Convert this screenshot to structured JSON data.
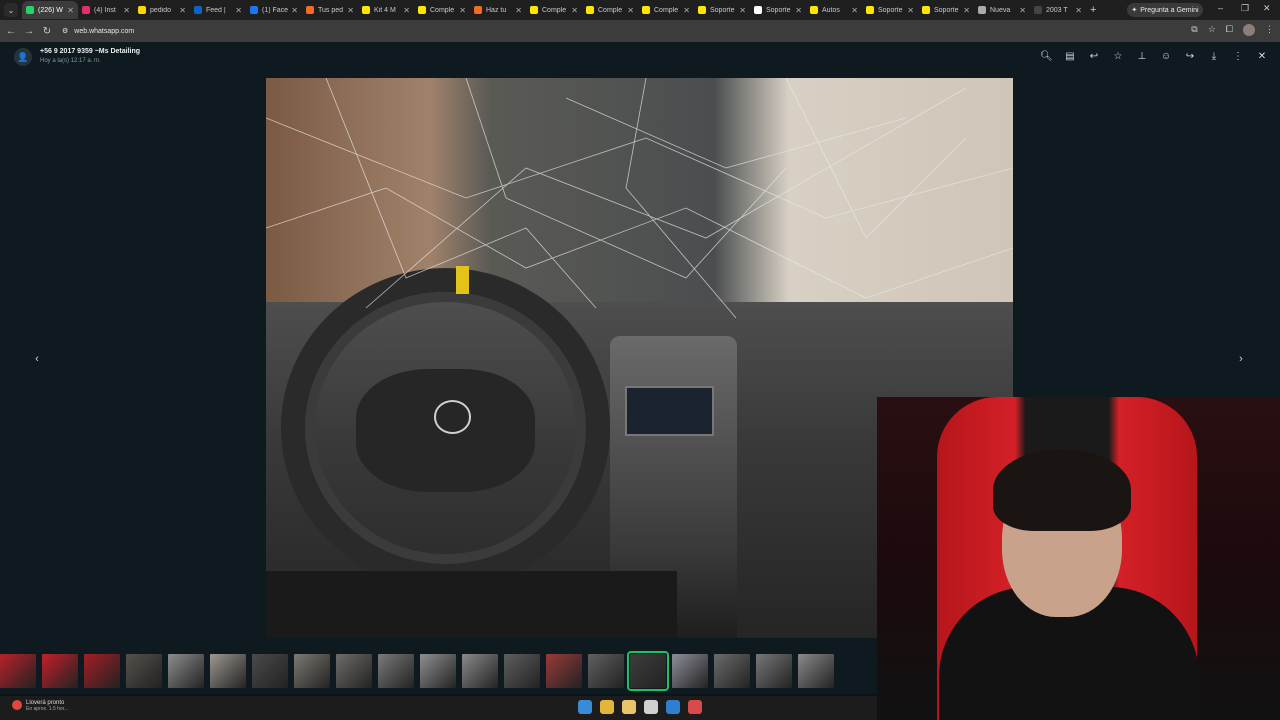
{
  "browser": {
    "tabs": [
      {
        "label": "(226) W",
        "color": "#25d366",
        "active": true
      },
      {
        "label": "(4) Inst",
        "color": "#e1306c"
      },
      {
        "label": "pedido",
        "color": "#ffd700"
      },
      {
        "label": "Feed |",
        "color": "#0a66c2"
      },
      {
        "label": "(1) Face",
        "color": "#1877f2"
      },
      {
        "label": "Tus ped",
        "color": "#f36c21"
      },
      {
        "label": "Kit 4 M",
        "color": "#ffe600"
      },
      {
        "label": "Comple",
        "color": "#ffe600"
      },
      {
        "label": "Haz tu",
        "color": "#f36c21"
      },
      {
        "label": "Comple",
        "color": "#ffe600"
      },
      {
        "label": "Comple",
        "color": "#ffe600"
      },
      {
        "label": "Comple",
        "color": "#ffe600"
      },
      {
        "label": "Soporte",
        "color": "#ffe600"
      },
      {
        "label": "Soporte",
        "color": "#ffffff"
      },
      {
        "label": "Autos",
        "color": "#ffe600"
      },
      {
        "label": "Soporte",
        "color": "#ffe600"
      },
      {
        "label": "Soporte",
        "color": "#ffe600"
      },
      {
        "label": "Nueva",
        "color": "#aaaaaa"
      },
      {
        "label": "2003 T",
        "color": "#444444"
      }
    ],
    "gemini_label": "Pregunta a Gemini",
    "url": "web.whatsapp.com"
  },
  "viewer": {
    "sender_name": "+56 9 2017 9359 ~Ms Detailing",
    "sender_time": "Hoy a la(s) 12:17 a. m.",
    "toolbar_icons": [
      "zoom-icon",
      "caption-icon",
      "reply-icon",
      "star-icon",
      "pin-icon",
      "emoji-icon",
      "forward-icon",
      "download-icon",
      "more-icon",
      "close-icon"
    ],
    "prev_icon": "chevron-left-icon",
    "next_icon": "chevron-right-icon"
  },
  "thumbnails": [
    {
      "color": "#b8222a"
    },
    {
      "color": "#c4202b"
    },
    {
      "color": "#a41e26"
    },
    {
      "color": "#55504c"
    },
    {
      "color": "#8d8d8d"
    },
    {
      "color": "#9c9891"
    },
    {
      "color": "#4a4a4a"
    },
    {
      "color": "#7d7a72"
    },
    {
      "color": "#6e6c68"
    },
    {
      "color": "#7a7a7a"
    },
    {
      "color": "#8f8f8f"
    },
    {
      "color": "#8a8a8a"
    },
    {
      "color": "#5e5e5e"
    },
    {
      "color": "#9a3a3a"
    },
    {
      "color": "#606060",
      "active": false
    },
    {
      "color": "#3d3d3d",
      "active": true
    },
    {
      "color": "#8e8e99"
    },
    {
      "color": "#6b6b6b"
    },
    {
      "color": "#777777"
    },
    {
      "color": "#8a8a8a"
    }
  ],
  "taskbar": {
    "weather_title": "Lloverá pronto",
    "weather_sub": "En aprox. 1.5 hor..."
  }
}
